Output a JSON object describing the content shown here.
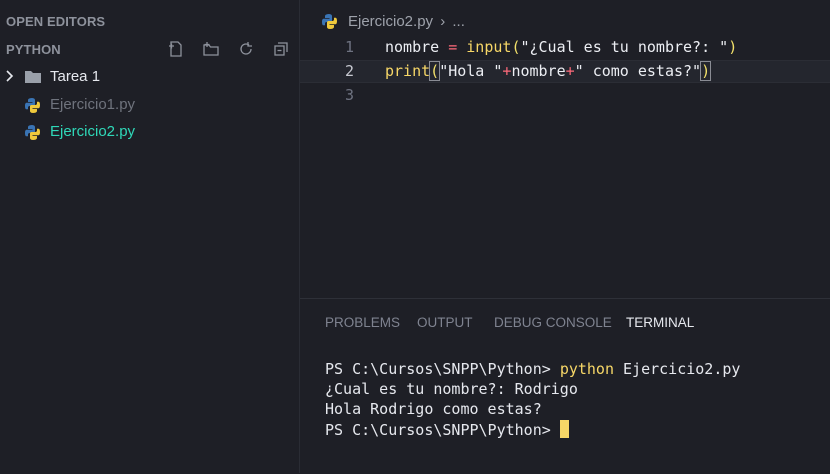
{
  "explorer": {
    "open_editors_title": "OPEN EDITORS",
    "workspace_title": "PYTHON",
    "toolbar": {
      "new_file_icon": "new-file-icon",
      "new_folder_icon": "new-folder-icon",
      "refresh_icon": "refresh-icon",
      "collapse_icon": "collapse-all-icon"
    },
    "tree": [
      {
        "label": "Tarea 1",
        "type": "folder",
        "color": "#e6e8ee"
      },
      {
        "label": "Ejercicio1.py",
        "type": "python-file",
        "color": "#6f737d"
      },
      {
        "label": "Ejercicio2.py",
        "type": "python-file",
        "color": "#2fd8b8"
      }
    ]
  },
  "editor": {
    "breadcrumb_file": "Ejercicio2.py",
    "breadcrumb_sep": "›",
    "breadcrumb_more": "...",
    "lines": [
      {
        "num": "1",
        "parts": {
          "a": "nombre",
          "b": " = ",
          "c": "input",
          "d": "(",
          "e": "\"¿Cual es tu nombre?: \"",
          "f": ")"
        }
      },
      {
        "num": "2",
        "parts": {
          "a": "print",
          "b": "(",
          "c": "\"Hola \"",
          "d": "+",
          "e": "nombre",
          "f": "+",
          "g": "\" como estas?\"",
          "h": ")"
        }
      },
      {
        "num": "3"
      }
    ]
  },
  "panel": {
    "tabs": [
      "PROBLEMS",
      "OUTPUT",
      "DEBUG CONSOLE",
      "TERMINAL"
    ],
    "active_tab": "TERMINAL",
    "terminal": {
      "prompt": "PS C:\\Cursos\\SNPP\\Python> ",
      "command": "python",
      "command_arg": " Ejercicio2.py",
      "output1": "¿Cual es tu nombre?: Rodrigo",
      "output2": "Hola Rodrigo como estas?",
      "prompt2": "PS C:\\Cursos\\SNPP\\Python> "
    }
  },
  "colors": {
    "background": "#1e1f26",
    "accent_file": "#2fd8b8",
    "cursor": "#f7d767",
    "operator": "#ff6a7b"
  }
}
